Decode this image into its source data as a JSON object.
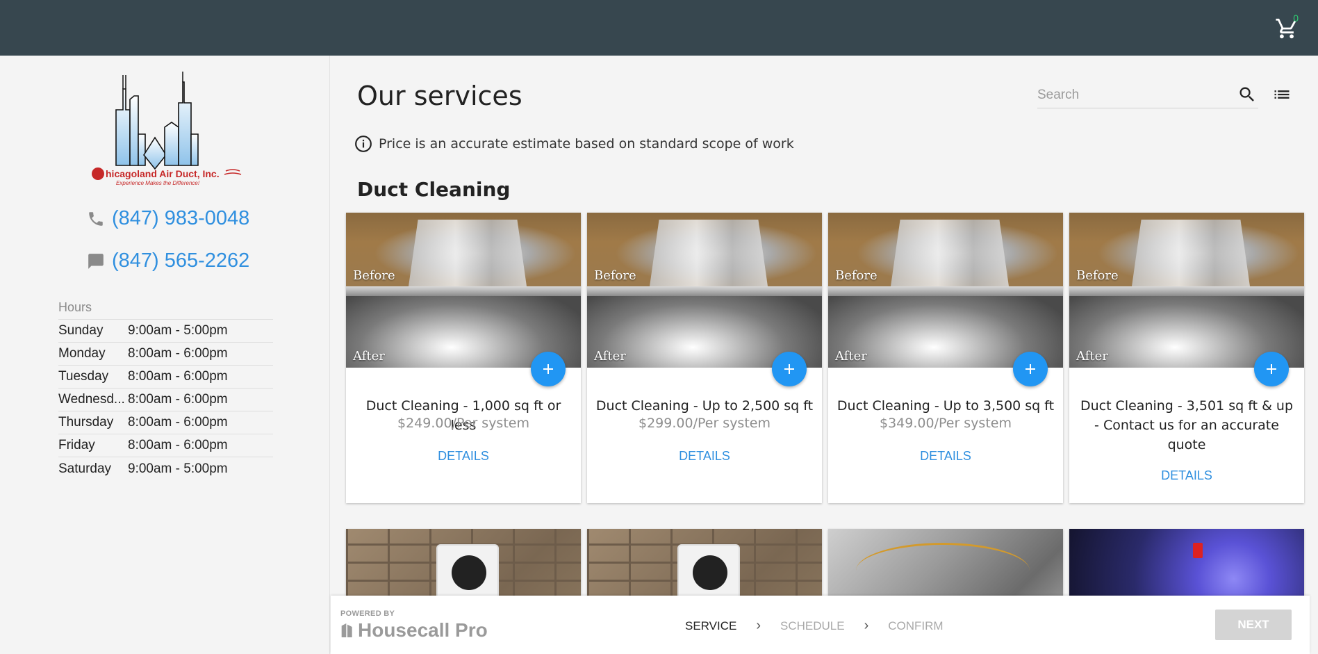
{
  "header": {
    "cart_count": "0",
    "cart_icon": "cart-icon"
  },
  "sidebar": {
    "logo": {
      "company": "Chicagoland Air Duct, Inc.",
      "tagline": "Experience Makes the Difference!"
    },
    "phone": "(847) 983-0048",
    "sms": "(847) 565-2262",
    "hours_title": "Hours",
    "hours": [
      {
        "day": "Sunday",
        "time": "9:00am - 5:00pm"
      },
      {
        "day": "Monday",
        "time": "8:00am - 6:00pm"
      },
      {
        "day": "Tuesday",
        "time": "8:00am - 6:00pm"
      },
      {
        "day": "Wednesd...",
        "time": "8:00am - 6:00pm"
      },
      {
        "day": "Thursday",
        "time": "8:00am - 6:00pm"
      },
      {
        "day": "Friday",
        "time": "8:00am - 6:00pm"
      },
      {
        "day": "Saturday",
        "time": "9:00am - 5:00pm"
      }
    ]
  },
  "main": {
    "title": "Our services",
    "search_placeholder": "Search",
    "notice": "Price is an accurate estimate based on standard scope of work",
    "section": "Duct Cleaning",
    "image_labels": {
      "before": "Before",
      "after": "After"
    },
    "cards": [
      {
        "name": "Duct Cleaning - 1,000 sq ft or less",
        "price": "$249.00/Per system",
        "details": "DETAILS"
      },
      {
        "name": "Duct Cleaning - Up to 2,500 sq ft",
        "price": "$299.00/Per system",
        "details": "DETAILS"
      },
      {
        "name": "Duct Cleaning - Up to 3,500 sq ft",
        "price": "$349.00/Per system",
        "details": "DETAILS"
      },
      {
        "name": "Duct Cleaning - 3,501 sq ft & up - Contact us for an accurate quote",
        "price": "",
        "details": "DETAILS"
      }
    ]
  },
  "footer": {
    "powered_by": "POWERED BY",
    "brand": "Housecall Pro",
    "steps": [
      "SERVICE",
      "SCHEDULE",
      "CONFIRM"
    ],
    "next": "NEXT"
  },
  "colors": {
    "topbar": "#37474f",
    "accent": "#2196f3",
    "link": "#2f8fdf"
  }
}
